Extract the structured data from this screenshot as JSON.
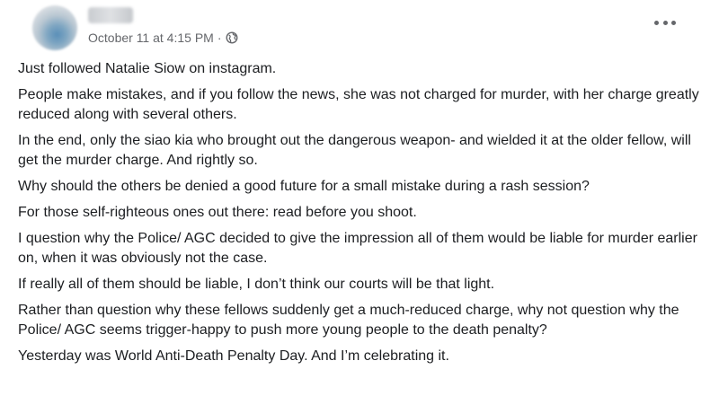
{
  "post": {
    "timestamp": "October 11 at 4:15 PM",
    "separator": "·",
    "privacy_icon": "globe-icon",
    "more_icon": "more-options-icon",
    "paragraphs": [
      "Just followed Natalie Siow on instagram.",
      "People make mistakes, and if you follow the news, she was not charged for murder, with her charge greatly reduced along with several others.",
      "In the end, only the siao kia who brought out the dangerous weapon- and wielded it at the older fellow, will get the murder charge. And rightly so.",
      "Why should the others be denied a good future for a small mistake during a rash session?",
      "For those self-righteous ones out there: read before you shoot.",
      "I question why the Police/ AGC decided to give the impression all of them would be liable for murder earlier on, when it was obviously not the case.",
      "If really all of them should be liable, I don’t think our courts will be that light.",
      "Rather than question why these fellows suddenly get a much-reduced charge, why not question why the Police/ AGC seems trigger-happy to push more young people to the death penalty?",
      "Yesterday was World Anti-Death Penalty Day. And I’m celebrating it."
    ]
  }
}
